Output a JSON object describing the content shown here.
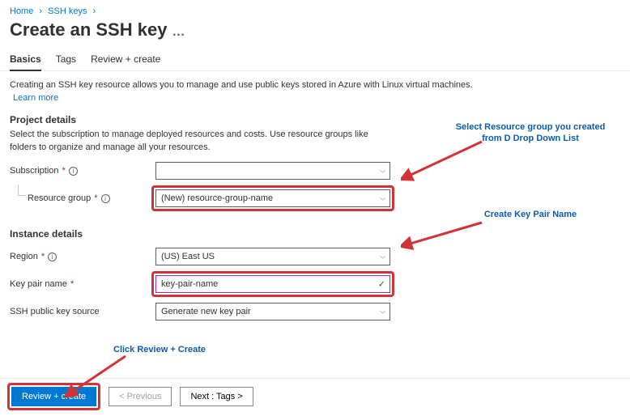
{
  "breadcrumb": {
    "home": "Home",
    "sshkeys": "SSH keys"
  },
  "page_title": "Create an SSH key",
  "tabs": {
    "basics": "Basics",
    "tags": "Tags",
    "review": "Review + create"
  },
  "intro": {
    "desc": "Creating an SSH key resource allows you to manage and use public keys stored in Azure with Linux virtual machines.",
    "learn_more": "Learn more"
  },
  "project": {
    "title": "Project details",
    "desc": "Select the subscription to manage deployed resources and costs. Use resource groups like folders to organize and manage all your resources.",
    "subscription_label": "Subscription",
    "subscription_value": "",
    "resource_group_label": "Resource group",
    "resource_group_value": "(New) resource-group-name"
  },
  "instance": {
    "title": "Instance details",
    "region_label": "Region",
    "region_value": "(US) East US",
    "keypair_label": "Key pair name",
    "keypair_value": "key-pair-name",
    "source_label": "SSH public key source",
    "source_value": "Generate new key pair"
  },
  "footer": {
    "review": "Review + create",
    "previous": "< Previous",
    "next": "Next : Tags >"
  },
  "annotations": {
    "rg": "Select Resource group you created from D Drop Down List",
    "kp": "Create Key Pair Name",
    "rc": "Click Review + Create"
  }
}
